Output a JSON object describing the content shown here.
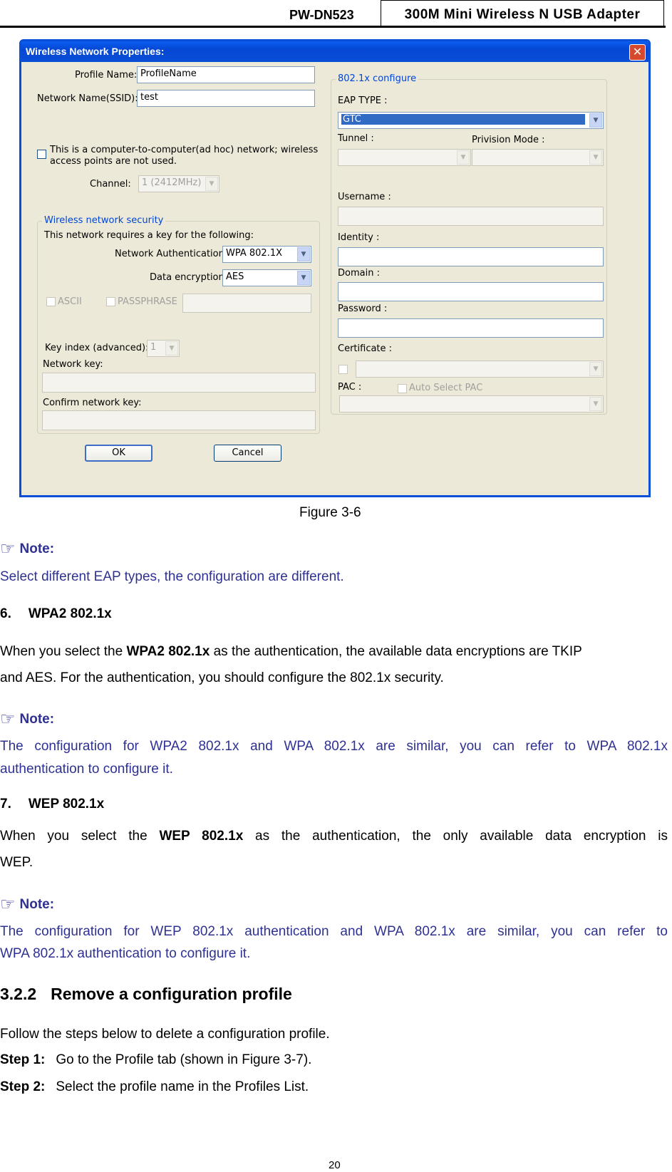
{
  "header": {
    "model": "PW-DN523",
    "product": "300M Mini Wireless N USB Adapter"
  },
  "dialog": {
    "title": "Wireless Network Properties:",
    "close_glyph": "✕",
    "profile_name_label": "Profile Name:",
    "profile_name_value": "ProfileName",
    "ssid_label": "Network Name(SSID):",
    "ssid_value": "test",
    "adhoc_text_1": "This is a computer-to-computer(ad hoc) network; wireless",
    "adhoc_text_2": "access points are not used.",
    "channel_label": "Channel:",
    "channel_value": "1  (2412MHz)",
    "security": {
      "legend": "Wireless network security",
      "intro": "This network requires a key for the following:",
      "auth_label": "Network Authentication:",
      "auth_value": "WPA 802.1X",
      "enc_label": "Data encryption:",
      "enc_value": "AES",
      "ascii_label": "ASCII",
      "passphrase_label": "PASSPHRASE",
      "key_index_label": "Key index (advanced):",
      "key_index_value": "1",
      "network_key_label": "Network key:",
      "confirm_key_label": "Confirm network key:"
    },
    "dot1x": {
      "legend": "802.1x configure",
      "eap_label": "EAP TYPE :",
      "eap_value": "GTC",
      "tunnel_label": "Tunnel :",
      "provision_label": "Privision Mode :",
      "username_label": "Username :",
      "identity_label": "Identity :",
      "domain_label": "Domain :",
      "password_label": "Password :",
      "certificate_label": "Certificate :",
      "pac_label": "PAC :",
      "auto_pac_label": "Auto Select PAC"
    },
    "ok_label": "OK",
    "cancel_label": "Cancel"
  },
  "figure_caption": "Figure 3-6",
  "note_icon": "hand-pointing-icon",
  "note_label": "Note:",
  "note1": "Select different EAP types, the configuration are different.",
  "section6": {
    "number": "6.",
    "title": "WPA2 802.1x"
  },
  "para6_pre": "When you select the ",
  "para6_bold": "WPA2 802.1x",
  "para6_post": " as the authentication, the available data encryptions are TKIP",
  "para6_line2": "and AES. For the authentication, you should configure the 802.1x security.",
  "note2_line1": "The configuration for WPA2 802.1x and WPA 802.1x are similar, you can refer to WPA 802.1x",
  "note2_line2": "authentication to configure it.",
  "section7": {
    "number": "7.",
    "title": "WEP 802.1x"
  },
  "para7_pre": "When you select the ",
  "para7_bold": "WEP 802.1x",
  "para7_post": " as the authentication, the only available data encryption is",
  "para7_line2": "WEP.",
  "note3_line1": "The configuration for WEP 802.1x authentication and WPA 802.1x are similar, you can refer to",
  "note3_line2": "WPA 802.1x authentication to configure it.",
  "section322": {
    "number": "3.2.2",
    "title": "Remove a configuration profile"
  },
  "steps_intro": "Follow the steps below to delete a configuration profile.",
  "step1": {
    "label": "Step 1:",
    "text": "Go to the Profile tab (shown in Figure 3-7)."
  },
  "step2": {
    "label": "Step 2:",
    "text": "Select the profile name in the Profiles List."
  },
  "page_number": "20",
  "colors": {
    "note_blue": "#2e3192",
    "xp_title_blue": "#0a4fd8",
    "dialog_bg": "#ece9d8",
    "legend_blue": "#0046d5"
  }
}
